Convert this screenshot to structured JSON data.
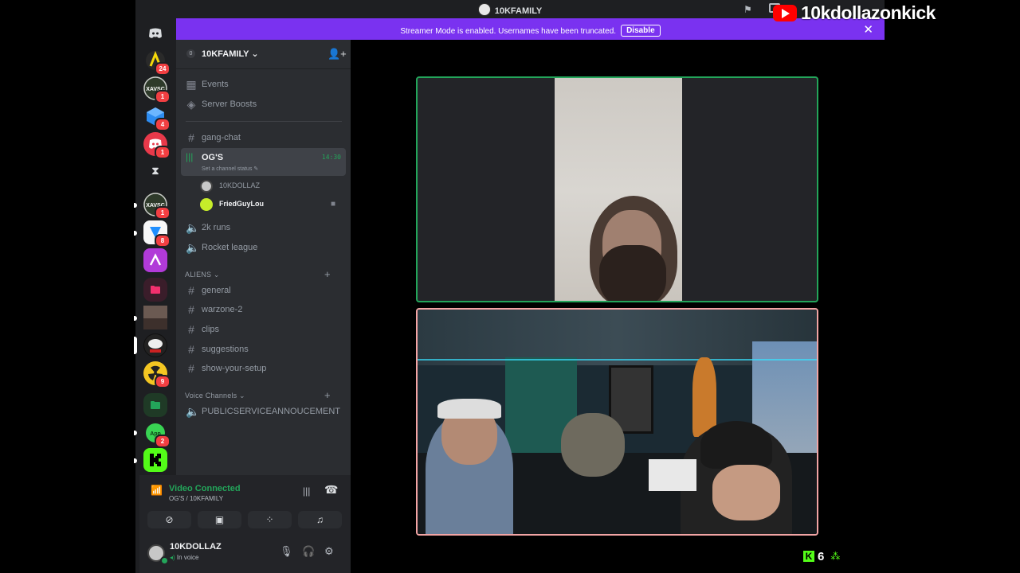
{
  "window": {
    "title": "10KFAMILY"
  },
  "overlay": {
    "youtube_handle": "10kdollazonkick",
    "kick_viewer_count": "6"
  },
  "banner": {
    "text": "Streamer Mode is enabled. Usernames have been truncated.",
    "button": "Disable",
    "close": "✕"
  },
  "servers": [
    {
      "icon": "yellow-server-icon",
      "badge": "24"
    },
    {
      "icon": "xavsc-server-icon",
      "badge": "1"
    },
    {
      "icon": "blue-cube-server-icon",
      "badge": "4"
    },
    {
      "icon": "red-discord-server-icon",
      "badge": "1"
    },
    {
      "icon": "hourglass-icon",
      "badge": ""
    },
    {
      "icon": "xavsc-server-icon",
      "badge": "1"
    },
    {
      "icon": "blue-app-server-icon",
      "badge": "8"
    },
    {
      "icon": "purple-app-server-icon",
      "badge": ""
    },
    {
      "icon": "red-folder-icon",
      "badge": ""
    },
    {
      "icon": "photo-server-icon",
      "badge": ""
    },
    {
      "icon": "mask-server-icon",
      "badge": ""
    },
    {
      "icon": "radioactive-server-icon",
      "badge": "9"
    },
    {
      "icon": "green-folder-icon",
      "badge": ""
    },
    {
      "icon": "green-blob-server-icon",
      "badge": "2"
    },
    {
      "icon": "kick-server-icon",
      "badge": ""
    }
  ],
  "guild": {
    "name": "10KFAMILY",
    "boost_level": "0",
    "top_links": [
      "Events",
      "Server Boosts"
    ]
  },
  "channels": {
    "gang_chat": "gang-chat",
    "active_voice": {
      "name": "OG'S",
      "status_placeholder": "Set a channel status",
      "timer": "14:30",
      "users": [
        "10KDOLLAZ",
        "FriedGuyLou"
      ]
    },
    "voice_more": [
      "2k runs",
      "Rocket league"
    ],
    "category_aliens": "ALIENS",
    "aliens_channels": [
      "general",
      "warzone-2",
      "clips",
      "suggestions",
      "show-your-setup"
    ],
    "category_voice": "Voice Channels",
    "voice_channels": [
      "PUBLICSERVICEANNOUCEMENT"
    ]
  },
  "voice_panel": {
    "status": "Video Connected",
    "location": "OG'S / 10KFAMILY"
  },
  "user_panel": {
    "name": "10KDOLLAZ",
    "status": "In voice"
  },
  "colors": {
    "accent_purple": "#7a32f0",
    "online_green": "#23a55a",
    "badge_red": "#f23f42",
    "kick_green": "#53fc18"
  }
}
